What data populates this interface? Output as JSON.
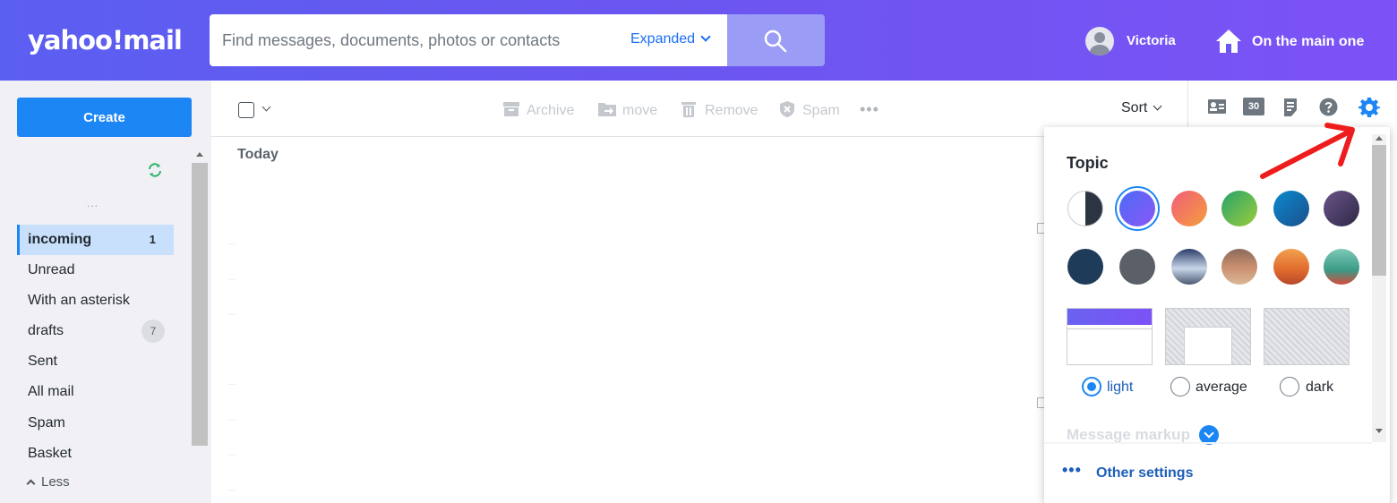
{
  "header": {
    "logo": "yahoo!mail",
    "search": {
      "placeholder": "Find messages, documents, photos or contacts",
      "mode": "Expanded"
    },
    "user_name": "Victoria",
    "home_label": "On the main one",
    "gradient": [
      "#5b5ff1",
      "#7c52f6"
    ]
  },
  "sidebar": {
    "create_label": "Create",
    "more_dots": "...",
    "folders": [
      {
        "label": "incoming",
        "count": "1",
        "active": true
      },
      {
        "label": "Unread"
      },
      {
        "label": "With an asterisk"
      },
      {
        "label": "drafts",
        "count": "7"
      },
      {
        "label": "Sent"
      },
      {
        "label": "All mail"
      },
      {
        "label": "Spam"
      },
      {
        "label": "Basket"
      }
    ],
    "less_label": "Less"
  },
  "toolbar": {
    "archive": "Archive",
    "move": "move",
    "remove": "Remove",
    "spam": "Spam",
    "more": "•••",
    "sort": "Sort",
    "calendar_day": "30"
  },
  "message_list": {
    "group_label": "Today"
  },
  "settings_panel": {
    "title": "Topic",
    "themes": [
      "contrast",
      "purple",
      "sunset",
      "green",
      "ocean",
      "dusk",
      "navy",
      "slate",
      "mountains",
      "desert",
      "kangaroo",
      "lighthouse"
    ],
    "selected_theme": "purple",
    "modes": [
      {
        "label": "light",
        "selected": true
      },
      {
        "label": "average",
        "selected": false
      },
      {
        "label": "dark",
        "selected": false
      }
    ],
    "message_markup_label": "Message markup",
    "other_settings_dots": "•••",
    "other_settings_label": "Other settings"
  }
}
